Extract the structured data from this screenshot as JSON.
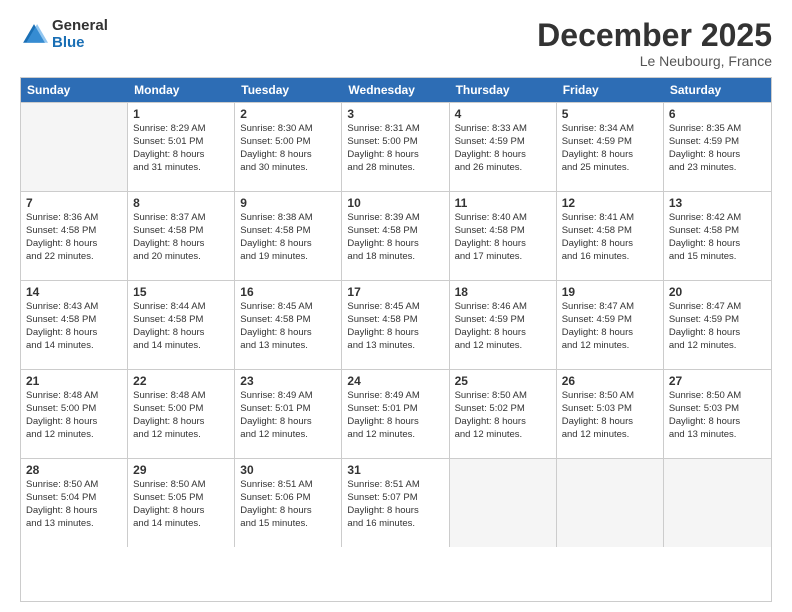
{
  "logo": {
    "general": "General",
    "blue": "Blue"
  },
  "title": "December 2025",
  "location": "Le Neubourg, France",
  "header_days": [
    "Sunday",
    "Monday",
    "Tuesday",
    "Wednesday",
    "Thursday",
    "Friday",
    "Saturday"
  ],
  "weeks": [
    [
      {
        "day": "",
        "lines": []
      },
      {
        "day": "1",
        "lines": [
          "Sunrise: 8:29 AM",
          "Sunset: 5:01 PM",
          "Daylight: 8 hours",
          "and 31 minutes."
        ]
      },
      {
        "day": "2",
        "lines": [
          "Sunrise: 8:30 AM",
          "Sunset: 5:00 PM",
          "Daylight: 8 hours",
          "and 30 minutes."
        ]
      },
      {
        "day": "3",
        "lines": [
          "Sunrise: 8:31 AM",
          "Sunset: 5:00 PM",
          "Daylight: 8 hours",
          "and 28 minutes."
        ]
      },
      {
        "day": "4",
        "lines": [
          "Sunrise: 8:33 AM",
          "Sunset: 4:59 PM",
          "Daylight: 8 hours",
          "and 26 minutes."
        ]
      },
      {
        "day": "5",
        "lines": [
          "Sunrise: 8:34 AM",
          "Sunset: 4:59 PM",
          "Daylight: 8 hours",
          "and 25 minutes."
        ]
      },
      {
        "day": "6",
        "lines": [
          "Sunrise: 8:35 AM",
          "Sunset: 4:59 PM",
          "Daylight: 8 hours",
          "and 23 minutes."
        ]
      }
    ],
    [
      {
        "day": "7",
        "lines": [
          "Sunrise: 8:36 AM",
          "Sunset: 4:58 PM",
          "Daylight: 8 hours",
          "and 22 minutes."
        ]
      },
      {
        "day": "8",
        "lines": [
          "Sunrise: 8:37 AM",
          "Sunset: 4:58 PM",
          "Daylight: 8 hours",
          "and 20 minutes."
        ]
      },
      {
        "day": "9",
        "lines": [
          "Sunrise: 8:38 AM",
          "Sunset: 4:58 PM",
          "Daylight: 8 hours",
          "and 19 minutes."
        ]
      },
      {
        "day": "10",
        "lines": [
          "Sunrise: 8:39 AM",
          "Sunset: 4:58 PM",
          "Daylight: 8 hours",
          "and 18 minutes."
        ]
      },
      {
        "day": "11",
        "lines": [
          "Sunrise: 8:40 AM",
          "Sunset: 4:58 PM",
          "Daylight: 8 hours",
          "and 17 minutes."
        ]
      },
      {
        "day": "12",
        "lines": [
          "Sunrise: 8:41 AM",
          "Sunset: 4:58 PM",
          "Daylight: 8 hours",
          "and 16 minutes."
        ]
      },
      {
        "day": "13",
        "lines": [
          "Sunrise: 8:42 AM",
          "Sunset: 4:58 PM",
          "Daylight: 8 hours",
          "and 15 minutes."
        ]
      }
    ],
    [
      {
        "day": "14",
        "lines": [
          "Sunrise: 8:43 AM",
          "Sunset: 4:58 PM",
          "Daylight: 8 hours",
          "and 14 minutes."
        ]
      },
      {
        "day": "15",
        "lines": [
          "Sunrise: 8:44 AM",
          "Sunset: 4:58 PM",
          "Daylight: 8 hours",
          "and 14 minutes."
        ]
      },
      {
        "day": "16",
        "lines": [
          "Sunrise: 8:45 AM",
          "Sunset: 4:58 PM",
          "Daylight: 8 hours",
          "and 13 minutes."
        ]
      },
      {
        "day": "17",
        "lines": [
          "Sunrise: 8:45 AM",
          "Sunset: 4:58 PM",
          "Daylight: 8 hours",
          "and 13 minutes."
        ]
      },
      {
        "day": "18",
        "lines": [
          "Sunrise: 8:46 AM",
          "Sunset: 4:59 PM",
          "Daylight: 8 hours",
          "and 12 minutes."
        ]
      },
      {
        "day": "19",
        "lines": [
          "Sunrise: 8:47 AM",
          "Sunset: 4:59 PM",
          "Daylight: 8 hours",
          "and 12 minutes."
        ]
      },
      {
        "day": "20",
        "lines": [
          "Sunrise: 8:47 AM",
          "Sunset: 4:59 PM",
          "Daylight: 8 hours",
          "and 12 minutes."
        ]
      }
    ],
    [
      {
        "day": "21",
        "lines": [
          "Sunrise: 8:48 AM",
          "Sunset: 5:00 PM",
          "Daylight: 8 hours",
          "and 12 minutes."
        ]
      },
      {
        "day": "22",
        "lines": [
          "Sunrise: 8:48 AM",
          "Sunset: 5:00 PM",
          "Daylight: 8 hours",
          "and 12 minutes."
        ]
      },
      {
        "day": "23",
        "lines": [
          "Sunrise: 8:49 AM",
          "Sunset: 5:01 PM",
          "Daylight: 8 hours",
          "and 12 minutes."
        ]
      },
      {
        "day": "24",
        "lines": [
          "Sunrise: 8:49 AM",
          "Sunset: 5:01 PM",
          "Daylight: 8 hours",
          "and 12 minutes."
        ]
      },
      {
        "day": "25",
        "lines": [
          "Sunrise: 8:50 AM",
          "Sunset: 5:02 PM",
          "Daylight: 8 hours",
          "and 12 minutes."
        ]
      },
      {
        "day": "26",
        "lines": [
          "Sunrise: 8:50 AM",
          "Sunset: 5:03 PM",
          "Daylight: 8 hours",
          "and 12 minutes."
        ]
      },
      {
        "day": "27",
        "lines": [
          "Sunrise: 8:50 AM",
          "Sunset: 5:03 PM",
          "Daylight: 8 hours",
          "and 13 minutes."
        ]
      }
    ],
    [
      {
        "day": "28",
        "lines": [
          "Sunrise: 8:50 AM",
          "Sunset: 5:04 PM",
          "Daylight: 8 hours",
          "and 13 minutes."
        ]
      },
      {
        "day": "29",
        "lines": [
          "Sunrise: 8:50 AM",
          "Sunset: 5:05 PM",
          "Daylight: 8 hours",
          "and 14 minutes."
        ]
      },
      {
        "day": "30",
        "lines": [
          "Sunrise: 8:51 AM",
          "Sunset: 5:06 PM",
          "Daylight: 8 hours",
          "and 15 minutes."
        ]
      },
      {
        "day": "31",
        "lines": [
          "Sunrise: 8:51 AM",
          "Sunset: 5:07 PM",
          "Daylight: 8 hours",
          "and 16 minutes."
        ]
      },
      {
        "day": "",
        "lines": []
      },
      {
        "day": "",
        "lines": []
      },
      {
        "day": "",
        "lines": []
      }
    ]
  ]
}
